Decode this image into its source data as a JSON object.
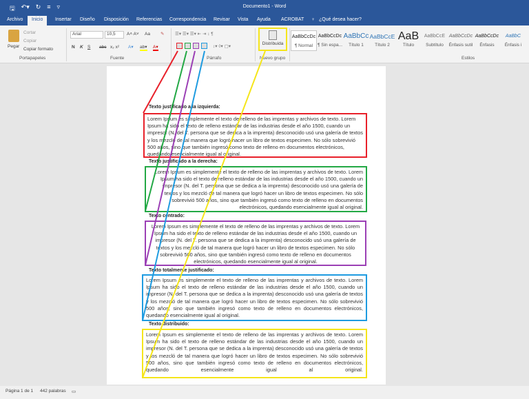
{
  "window": {
    "title": "Documento1  -  Word"
  },
  "tabs": [
    "Archivo",
    "Inicio",
    "Insertar",
    "Diseño",
    "Disposición",
    "Referencias",
    "Correspondencia",
    "Revisar",
    "Vista",
    "Ayuda",
    "ACROBAT"
  ],
  "active_tab": "Inicio",
  "tell_me": "¿Qué desea hacer?",
  "clipboard": {
    "paste": "Pegar",
    "cut": "Cortar",
    "copy": "Copiar",
    "format_painter": "Copiar formato",
    "group": "Portapapeles"
  },
  "font": {
    "name": "Arial",
    "size": "10,5",
    "bold": "N",
    "italic": "K",
    "underline": "S",
    "strike": "abc",
    "case": "Aa",
    "group": "Fuente"
  },
  "paragraph": {
    "group": "Párrafo"
  },
  "new_group": {
    "button": "Distribuida",
    "group": "Nuevo grupo"
  },
  "styles": {
    "group": "Estilos",
    "items": [
      {
        "sample": "AaBbCcDc",
        "name": "¶ Normal"
      },
      {
        "sample": "AaBbCcDc",
        "name": "¶ Sin espa..."
      },
      {
        "sample": "AaBbCc",
        "name": "Título 1"
      },
      {
        "sample": "AaBbCcE",
        "name": "Título 2"
      },
      {
        "sample": "AaB",
        "name": "Título"
      },
      {
        "sample": "AaBbCcE",
        "name": "Subtítulo"
      },
      {
        "sample": "AaBbCcDc",
        "name": "Énfasis sutil"
      },
      {
        "sample": "AaBbCcDc",
        "name": "Énfasis"
      },
      {
        "sample": "AaBbC",
        "name": "Énfasis i"
      }
    ]
  },
  "annotation_colors": {
    "left": "#e8202a",
    "right": "#22a844",
    "center": "#9b3fb5",
    "justify": "#1e9be0",
    "distributed": "#f5e51a"
  },
  "document": {
    "sections": [
      {
        "heading": "Texto justificado a la izquierda:",
        "text": "Lorem Ipsum es simplemente el texto de relleno de las imprentas y archivos de texto. Lorem Ipsum ha sido el texto de relleno estándar de las industrias desde el año 1500, cuando un impresor (N. del T. persona que se dedica a la imprenta) desconocido usó una galería de textos y los mezcló de tal manera que logró hacer un libro de textos especimen. No sólo sobrevivió 500 años, sino que también ingresó como texto de relleno en documentos electrónicos, quedando esencialmente igual al original."
      },
      {
        "heading": "Texto justificado a la derecha:",
        "text": "Lorem Ipsum es simplemente el texto de relleno de las imprentas y archivos de texto. Lorem Ipsum ha sido el texto de relleno estándar de las industrias desde el año 1500, cuando un impresor (N. del T. persona que se dedica a la imprenta) desconocido usó una galería de textos y los mezcló de tal manera que logró hacer un libro de textos especimen. No sólo sobrevivió 500 años, sino que también ingresó como texto de relleno en documentos electrónicos, quedando esencialmente igual al original."
      },
      {
        "heading": "Texto centrado:",
        "text": "Lorem Ipsum es simplemente el texto de relleno de las imprentas y archivos de texto. Lorem Ipsum ha sido el texto de relleno estándar de las industrias desde el año 1500, cuando un impresor (N. del T. persona que se dedica a la imprenta) desconocido usó una galería de textos y los mezcló de tal manera que logró hacer un libro de textos especimen. No sólo sobrevivió 500 años, sino que también ingresó como texto de relleno en documentos electrónicos, quedando esencialmente igual al original."
      },
      {
        "heading": "Texto totalmente justificado:",
        "text": "Lorem Ipsum es simplemente el texto de relleno de las imprentas y archivos de texto. Lorem Ipsum ha sido el texto de relleno estándar de las industrias desde el año 1500, cuando un impresor (N. del T. persona que se dedica a la imprenta) desconocido usó una galería de textos y los mezcló de tal manera que logró hacer un libro de textos especimen. No sólo sobrevivió 500 años, sino que también ingresó como texto de relleno en documentos electrónicos, quedando esencialmente igual al original."
      },
      {
        "heading": "Texto distribuido:",
        "text": "Lorem Ipsum es simplemente el texto de relleno de las imprentas y archivos de texto. Lorem Ipsum ha sido el texto de relleno estándar de las industrias desde el año 1500, cuando un impresor (N. del T. persona que se dedica a la imprenta) desconocido usó una galería de textos y los mezcló de tal manera que logró hacer un libro de textos especimen. No sólo sobrevivió 500 años, sino que también ingresó como texto de relleno en documentos electrónicos, quedando esencialmente igual al original."
      }
    ]
  },
  "status": {
    "page": "Página 1 de 1",
    "words": "442 palabras"
  }
}
